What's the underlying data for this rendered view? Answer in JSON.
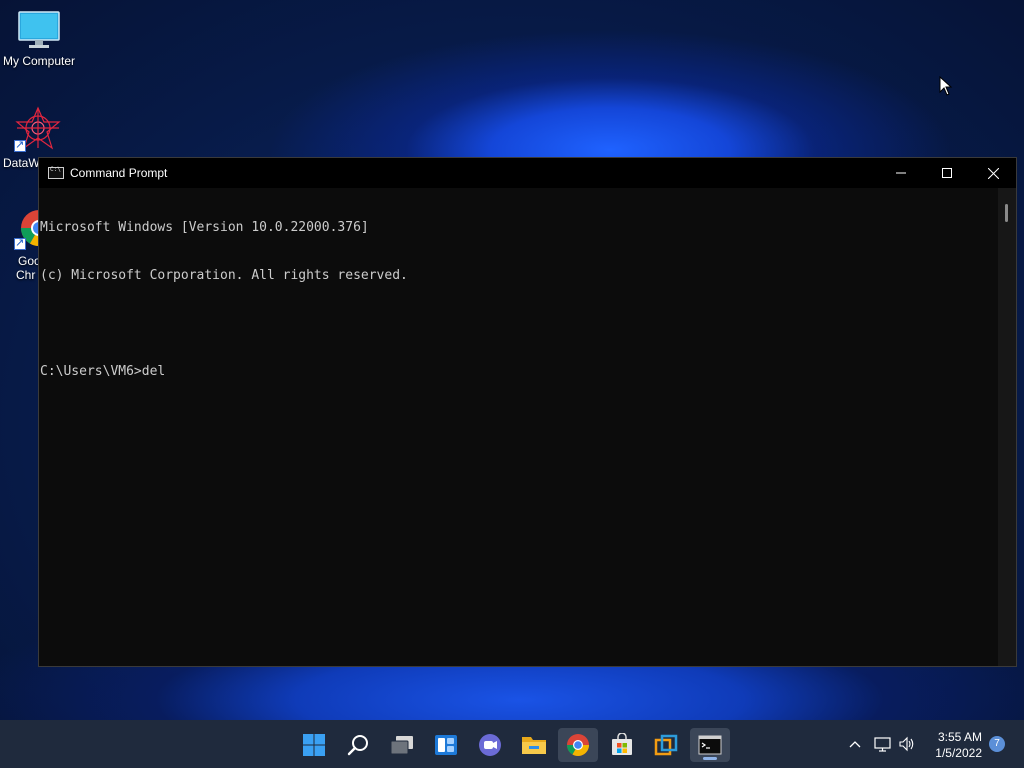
{
  "desktop": {
    "icons": [
      {
        "label": "My Computer"
      },
      {
        "label": "DataW"
      },
      {
        "label": "Goo",
        "label2": "Chr"
      }
    ]
  },
  "window": {
    "title": "Command Prompt",
    "console_lines": [
      "Microsoft Windows [Version 10.0.22000.376]",
      "(c) Microsoft Corporation. All rights reserved.",
      "",
      "C:\\Users\\VM6>del"
    ]
  },
  "taskbar": {
    "icons": [
      "start-icon",
      "search-icon",
      "task-view-icon",
      "widgets-icon",
      "chat-icon",
      "file-explorer-icon",
      "chrome-icon",
      "store-icon",
      "app-icon",
      "command-prompt-icon"
    ],
    "clock": {
      "time": "3:55 AM",
      "date": "1/5/2022"
    },
    "notification_count": "7"
  },
  "colors": {
    "taskbar": "#1f2a3d",
    "console_bg": "#0c0c0c",
    "console_text": "#cccccc",
    "accent": "#5b8fd8"
  }
}
